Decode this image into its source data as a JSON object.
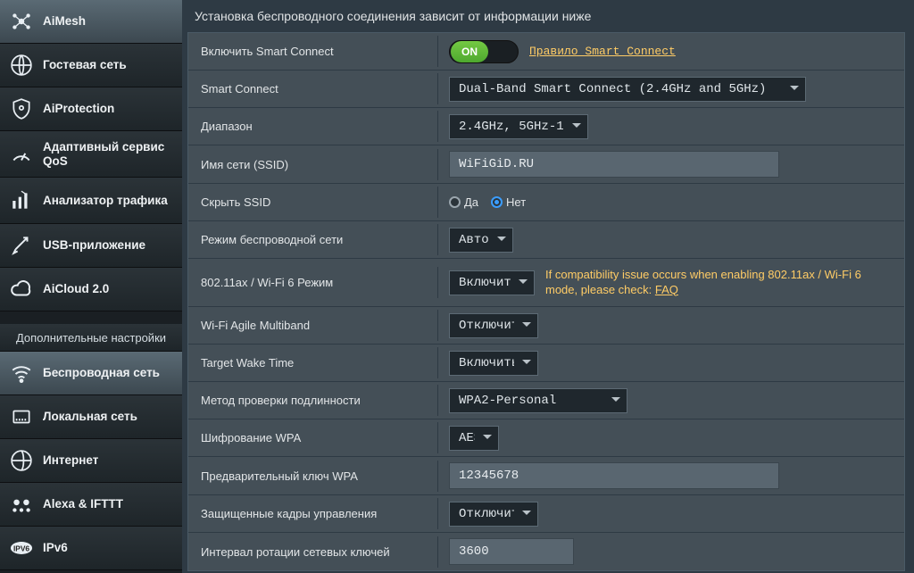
{
  "sidebar": {
    "general": [
      {
        "label": "AiMesh"
      },
      {
        "label": "Гостевая сеть"
      },
      {
        "label": "AiProtection"
      },
      {
        "label": "Адаптивный сервис QoS"
      },
      {
        "label": "Анализатор трафика"
      },
      {
        "label": "USB-приложение"
      },
      {
        "label": "AiCloud 2.0"
      }
    ],
    "advanced_title": "Дополнительные настройки",
    "advanced": [
      {
        "label": "Беспроводная сеть"
      },
      {
        "label": "Локальная сеть"
      },
      {
        "label": "Интернет"
      },
      {
        "label": "Alexa & IFTTT"
      },
      {
        "label": "IPv6"
      }
    ]
  },
  "main": {
    "header": "Установка беспроводного соединения зависит от информации ниже",
    "rows": {
      "enable_smart_connect": {
        "label": "Включить Smart Connect"
      },
      "smart_connect_rule_link": "Правило Smart Connect",
      "toggle_on": "ON",
      "smart_connect": {
        "label": "Smart Connect",
        "value": "Dual-Band Smart Connect (2.4GHz and 5GHz)"
      },
      "band": {
        "label": "Диапазон",
        "value": "2.4GHz, 5GHz-1"
      },
      "ssid": {
        "label": "Имя сети (SSID)",
        "value": "WiFiGiD.RU"
      },
      "hide_ssid": {
        "label": "Скрыть SSID",
        "yes": "Да",
        "no": "Нет"
      },
      "wireless_mode": {
        "label": "Режим беспроводной сети",
        "value": "Авто"
      },
      "wifi6_mode": {
        "label": "802.11ax / Wi-Fi 6 Режим",
        "value": "Включить",
        "note1": "If compatibility issue occurs when enabling 802.11ax / Wi-Fi 6 mode, please check: ",
        "faq": "FAQ"
      },
      "agile": {
        "label": "Wi-Fi Agile Multiband",
        "value": "Отключить"
      },
      "twt": {
        "label": "Target Wake Time",
        "value": "Включить"
      },
      "auth": {
        "label": "Метод проверки подлинности",
        "value": "WPA2-Personal"
      },
      "cipher": {
        "label": "Шифрование WPA",
        "value": "AES"
      },
      "psk": {
        "label": "Предварительный ключ WPA",
        "value": "12345678"
      },
      "pmf": {
        "label": "Защищенные кадры управления",
        "value": "Отключить"
      },
      "rekey": {
        "label": "Интервал ротации сетевых ключей",
        "value": "3600"
      }
    }
  }
}
